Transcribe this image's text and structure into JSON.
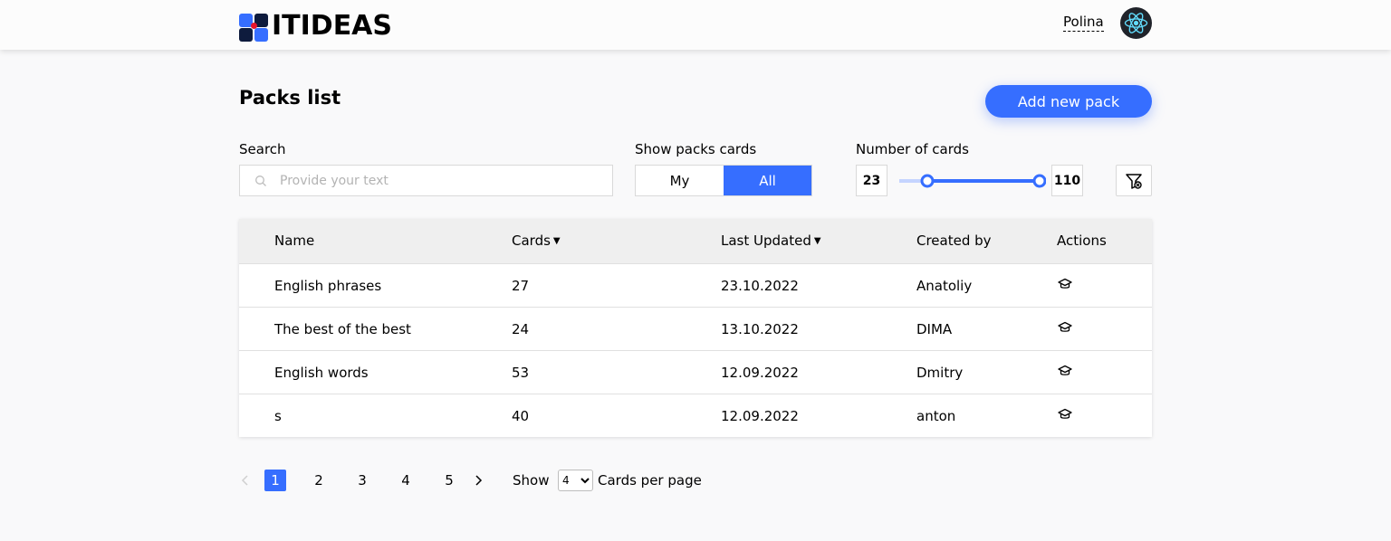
{
  "header": {
    "logo_text": "ITIDEAS",
    "user_name": "Polina",
    "avatar_icon": "react-logo-icon"
  },
  "page": {
    "title": "Packs list",
    "add_button": "Add new pack"
  },
  "filters": {
    "search_label": "Search",
    "search_placeholder": "Provide your text",
    "search_value": "",
    "show_label": "Show packs cards",
    "show_options": [
      "My",
      "All"
    ],
    "show_selected": "All",
    "number_label": "Number of cards",
    "min_value": "23",
    "max_value": "110",
    "filter_icon": "filter-reset-icon"
  },
  "table": {
    "columns": [
      "Name",
      "Cards",
      "Last Updated",
      "Created by",
      "Actions"
    ],
    "sortable": [
      "Cards",
      "Last Updated"
    ],
    "rows": [
      {
        "name": "English phrases",
        "cards": "27",
        "updated": "23.10.2022",
        "author": "Anatoliy",
        "action_icon": "learn-icon"
      },
      {
        "name": "The best of the best",
        "cards": "24",
        "updated": "13.10.2022",
        "author": "DIMA",
        "action_icon": "learn-icon"
      },
      {
        "name": "English words",
        "cards": "53",
        "updated": "12.09.2022",
        "author": "Dmitry",
        "action_icon": "learn-icon"
      },
      {
        "name": "s",
        "cards": "40",
        "updated": "12.09.2022",
        "author": "anton",
        "action_icon": "learn-icon"
      }
    ]
  },
  "pagination": {
    "pages": [
      "1",
      "2",
      "3",
      "4",
      "5"
    ],
    "current": "1",
    "show_label": "Show",
    "per_page": "4",
    "per_page_suffix": "Cards per page"
  },
  "colors": {
    "accent": "#366eff",
    "header_bg": "#fcfcfc",
    "table_head_bg": "#efefef"
  }
}
